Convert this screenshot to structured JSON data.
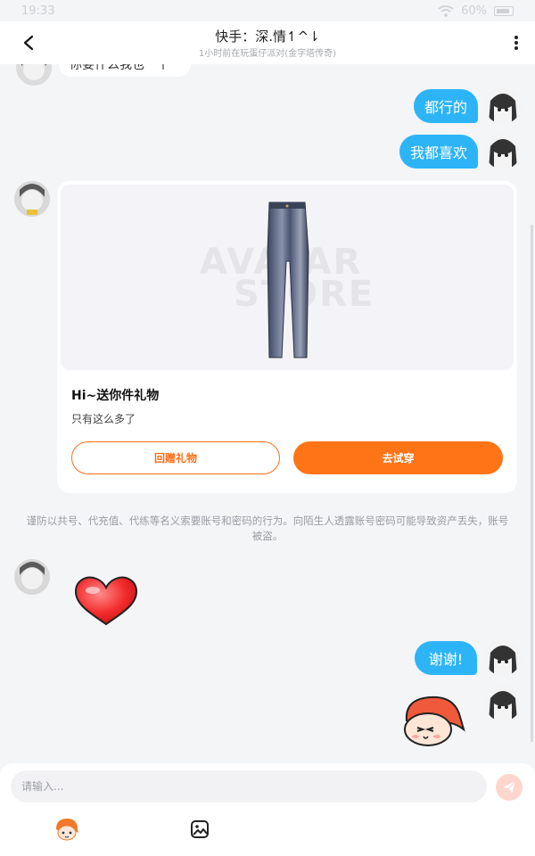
{
  "status_bar": {
    "time": "19:33",
    "battery": "60%"
  },
  "header": {
    "title": "快手：深.情↿^⇂",
    "subtitle": "1小时前在玩蛋仔派对(金字塔传奇)"
  },
  "messages": {
    "partial_incoming_text": "你要什么我也一个",
    "outgoing_1": "都行的",
    "outgoing_2": "我都喜欢",
    "outgoing_3": "谢谢!"
  },
  "gift_card": {
    "watermark_line1": "AVATAR",
    "watermark_line2": "STORE",
    "title": "Hi~送你件礼物",
    "description": "只有这么多了",
    "return_gift_label": "回赠礼物",
    "try_on_label": "去试穿"
  },
  "warning_text": "谨防以共号、代充值、代练等名义索要账号和密码的行为。向陌生人透露账号密码可能导致资产丢失，账号被盗。",
  "input": {
    "placeholder": "请输入..."
  },
  "icons": {
    "back": "chevron-left-icon",
    "more": "more-vertical-icon",
    "send": "send-icon",
    "sticker": "avatar-sticker-icon",
    "image": "image-icon",
    "heart_sticker": "heart-icon",
    "cartoon_sticker": "cartoon-face-icon"
  },
  "colors": {
    "outgoing_bubble": "#2db4f7",
    "accent_orange": "#ff7417",
    "background": "#f4f5f7"
  }
}
